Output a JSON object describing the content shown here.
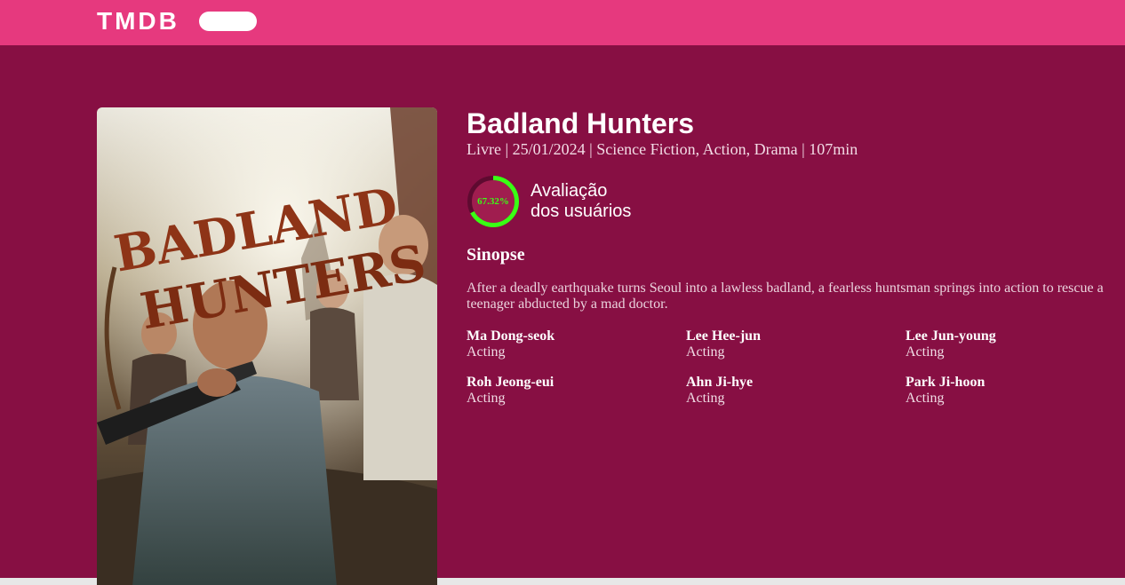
{
  "header": {
    "logo_text": "TMDB",
    "brand_color": "#e6397e"
  },
  "movie": {
    "title": "Badland Hunters",
    "meta": "Livre | 25/01/2024 | Science Fiction, Action, Drama | 107min",
    "rating": {
      "value_text": "67.32%",
      "value": 67.32,
      "label_line1": "Avaliação",
      "label_line2": "dos usuários",
      "ring_color": "#39ff14"
    },
    "synopsis_title": "Sinopse",
    "overview": "After a deadly earthquake turns Seoul into a lawless badland, a fearless huntsman springs into action to rescue a teenager abducted by a mad doctor.",
    "poster": {
      "title_line1": "BADLAND",
      "title_line2": "HUNTERS"
    },
    "cast": [
      {
        "name": "Ma Dong-seok",
        "role": "Acting"
      },
      {
        "name": "Lee Hee-jun",
        "role": "Acting"
      },
      {
        "name": "Lee Jun-young",
        "role": "Acting"
      },
      {
        "name": "Roh Jeong-eui",
        "role": "Acting"
      },
      {
        "name": "Ahn Ji-hye",
        "role": "Acting"
      },
      {
        "name": "Park Ji-hoon",
        "role": "Acting"
      }
    ]
  },
  "colors": {
    "hero_background": "#870f43"
  }
}
